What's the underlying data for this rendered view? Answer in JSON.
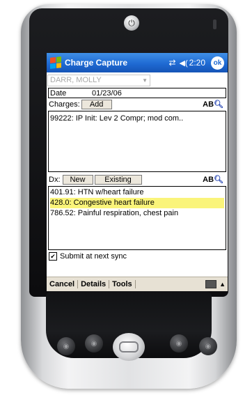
{
  "app": {
    "title": "Charge Capture",
    "time": "2:20",
    "ok_label": "ok",
    "sync_icon": "sync-arrows-icon",
    "volume_icon": "speaker-icon"
  },
  "patient": {
    "name": "DARR, MOLLY"
  },
  "date": {
    "label": "Date",
    "value": "01/23/06"
  },
  "charges": {
    "label": "Charges:",
    "add_label": "Add",
    "items": [
      "99222: IP Init: Lev 2 Compr; mod com.."
    ]
  },
  "dx": {
    "label": "Dx:",
    "new_label": "New",
    "existing_label": "Existing",
    "items": [
      "401.91: HTN w/heart failure",
      "428.0: Congestive heart failure",
      "786.52: Painful respiration, chest pain"
    ],
    "selected_index": 1,
    "highlight_color": "#faf47a"
  },
  "submit": {
    "label": "Submit at next sync",
    "checked": true
  },
  "menu": {
    "items": [
      "Cancel",
      "Details",
      "Tools"
    ]
  },
  "colors": {
    "titlebar": "#1f6ad3",
    "menubar": "#e7e1d4"
  }
}
